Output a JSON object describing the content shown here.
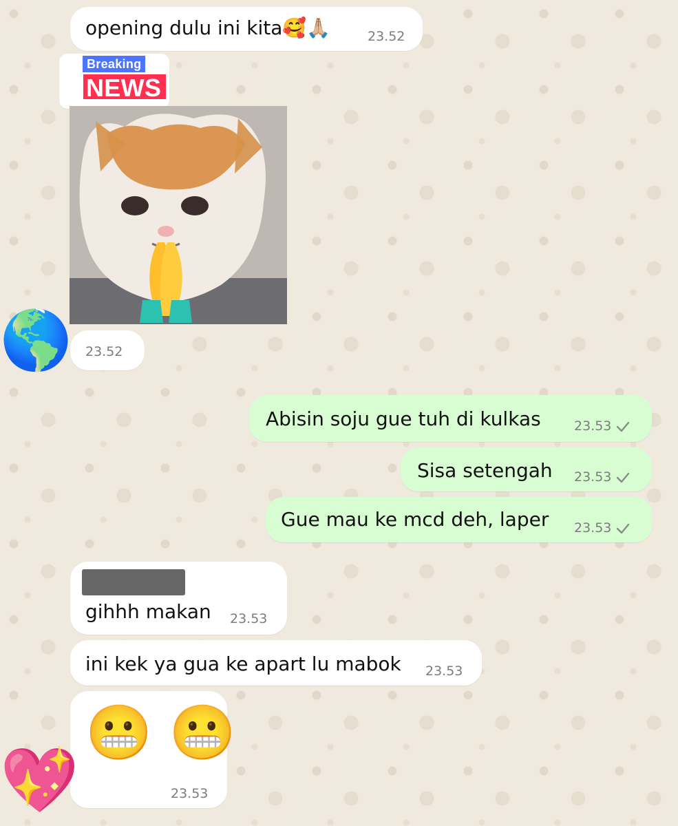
{
  "chat": {
    "messages": [
      {
        "direction": "incoming",
        "text": "opening dulu ini kita🥰🙏🏼",
        "time": "23.52"
      },
      {
        "direction": "incoming",
        "sticker_text_top": "Breaking",
        "sticker_text_bottom": "NEWS",
        "image": "cat-praying-hands",
        "time": "23.52"
      },
      {
        "direction": "outgoing",
        "text": "Abisin soju gue tuh di kulkas",
        "time": "23.53",
        "status": "sent"
      },
      {
        "direction": "outgoing",
        "text": "Sisa setengah",
        "time": "23.53",
        "status": "sent"
      },
      {
        "direction": "outgoing",
        "text": "Gue mau ke mcd deh, laper",
        "time": "23.53",
        "status": "sent"
      },
      {
        "direction": "incoming",
        "text": "gihhh makan",
        "time": "23.53"
      },
      {
        "direction": "incoming",
        "text": "ini kek ya gua ke apart lu mabok",
        "time": "23.53"
      },
      {
        "direction": "incoming",
        "emoji": "😬 😬",
        "time": "23.53"
      }
    ],
    "reactions": {
      "earth": "🌎",
      "heart": "💖"
    }
  },
  "colors": {
    "incoming_bubble": "#ffffff",
    "outgoing_bubble": "#d9fdd3",
    "wallpaper": "#efe9de",
    "breaking_blue": "#4b74ff",
    "breaking_red": "#ff2f4f"
  }
}
